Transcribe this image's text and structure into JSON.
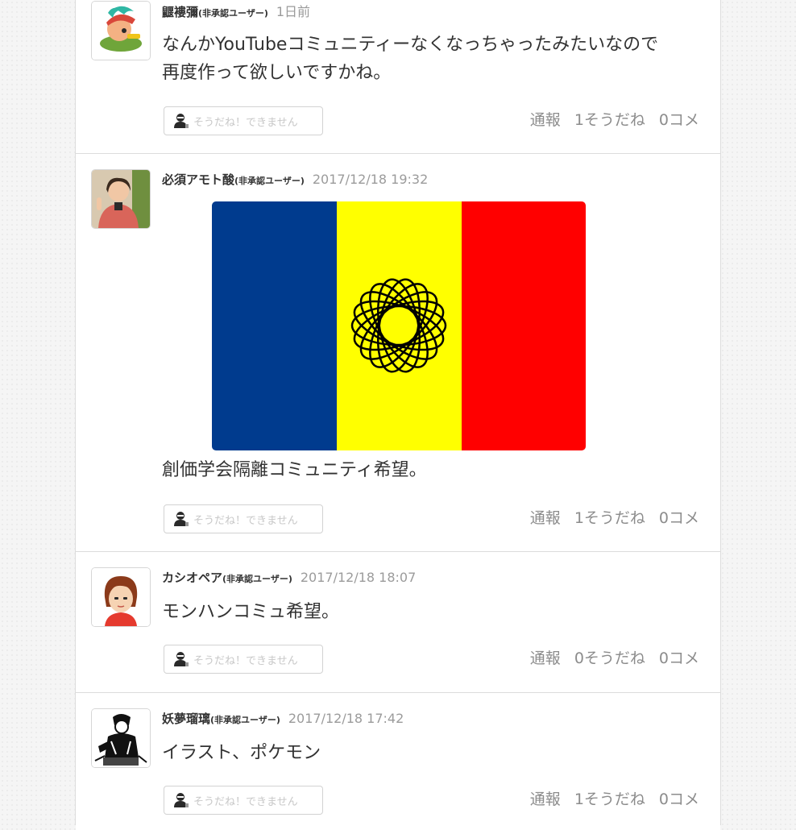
{
  "badge_text": "(非承認ユーザー)",
  "empathy_button_label": "そうだね！できません",
  "report_label": "通報",
  "posts": [
    {
      "user": "鼴褸彌",
      "time": "1日前",
      "lines": [
        "なんかYouTubeコミュニティーなくなっちゃったみたいなので",
        "再度作って欲しいですかね。"
      ],
      "yeah": "1そうだね",
      "comments": "0コメ"
    },
    {
      "user": "必須アモト酸",
      "time": "2017/12/18 19:32",
      "lines": [
        "創価学会隔離コミュニティ希望。"
      ],
      "yeah": "1そうだね",
      "comments": "0コメ"
    },
    {
      "user": "カシオペア",
      "time": "2017/12/18 18:07",
      "lines": [
        "モンハンコミュ希望。"
      ],
      "yeah": "0そうだね",
      "comments": "0コメ"
    },
    {
      "user": "妖夢瑠璃",
      "time": "2017/12/18 17:42",
      "lines": [
        "イラスト、ポケモン"
      ],
      "yeah": "1そうだね",
      "comments": "0コメ"
    }
  ],
  "colors": {
    "flag_blue": "#003b8e",
    "flag_yellow": "#ffff00",
    "flag_red": "#ff0000"
  },
  "icons": [
    "empathy-person-icon"
  ]
}
